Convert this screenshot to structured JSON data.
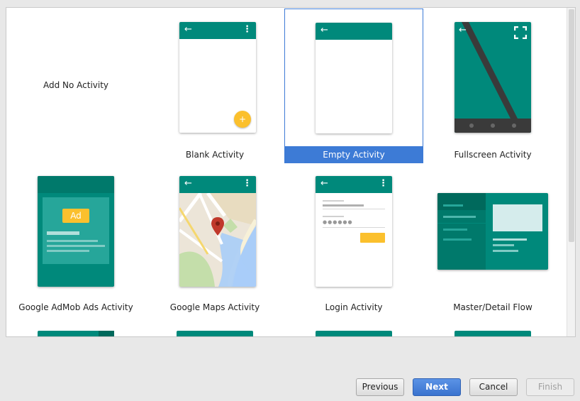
{
  "gallery": {
    "tiles": [
      {
        "label": "Add No Activity"
      },
      {
        "label": "Blank Activity"
      },
      {
        "label": "Empty Activity"
      },
      {
        "label": "Fullscreen Activity"
      },
      {
        "label": "Google AdMob Ads Activity",
        "ad_text": "Ad"
      },
      {
        "label": "Google Maps Activity"
      },
      {
        "label": "Login Activity"
      },
      {
        "label": "Master/Detail Flow"
      }
    ],
    "selected_index": 2
  },
  "buttons": {
    "previous": "Previous",
    "next": "Next",
    "cancel": "Cancel",
    "finish": "Finish"
  },
  "colors": {
    "teal": "#00897b",
    "teal_dark": "#00796b",
    "selection": "#3d7bd6",
    "fab_yellow": "#fbc02d"
  }
}
